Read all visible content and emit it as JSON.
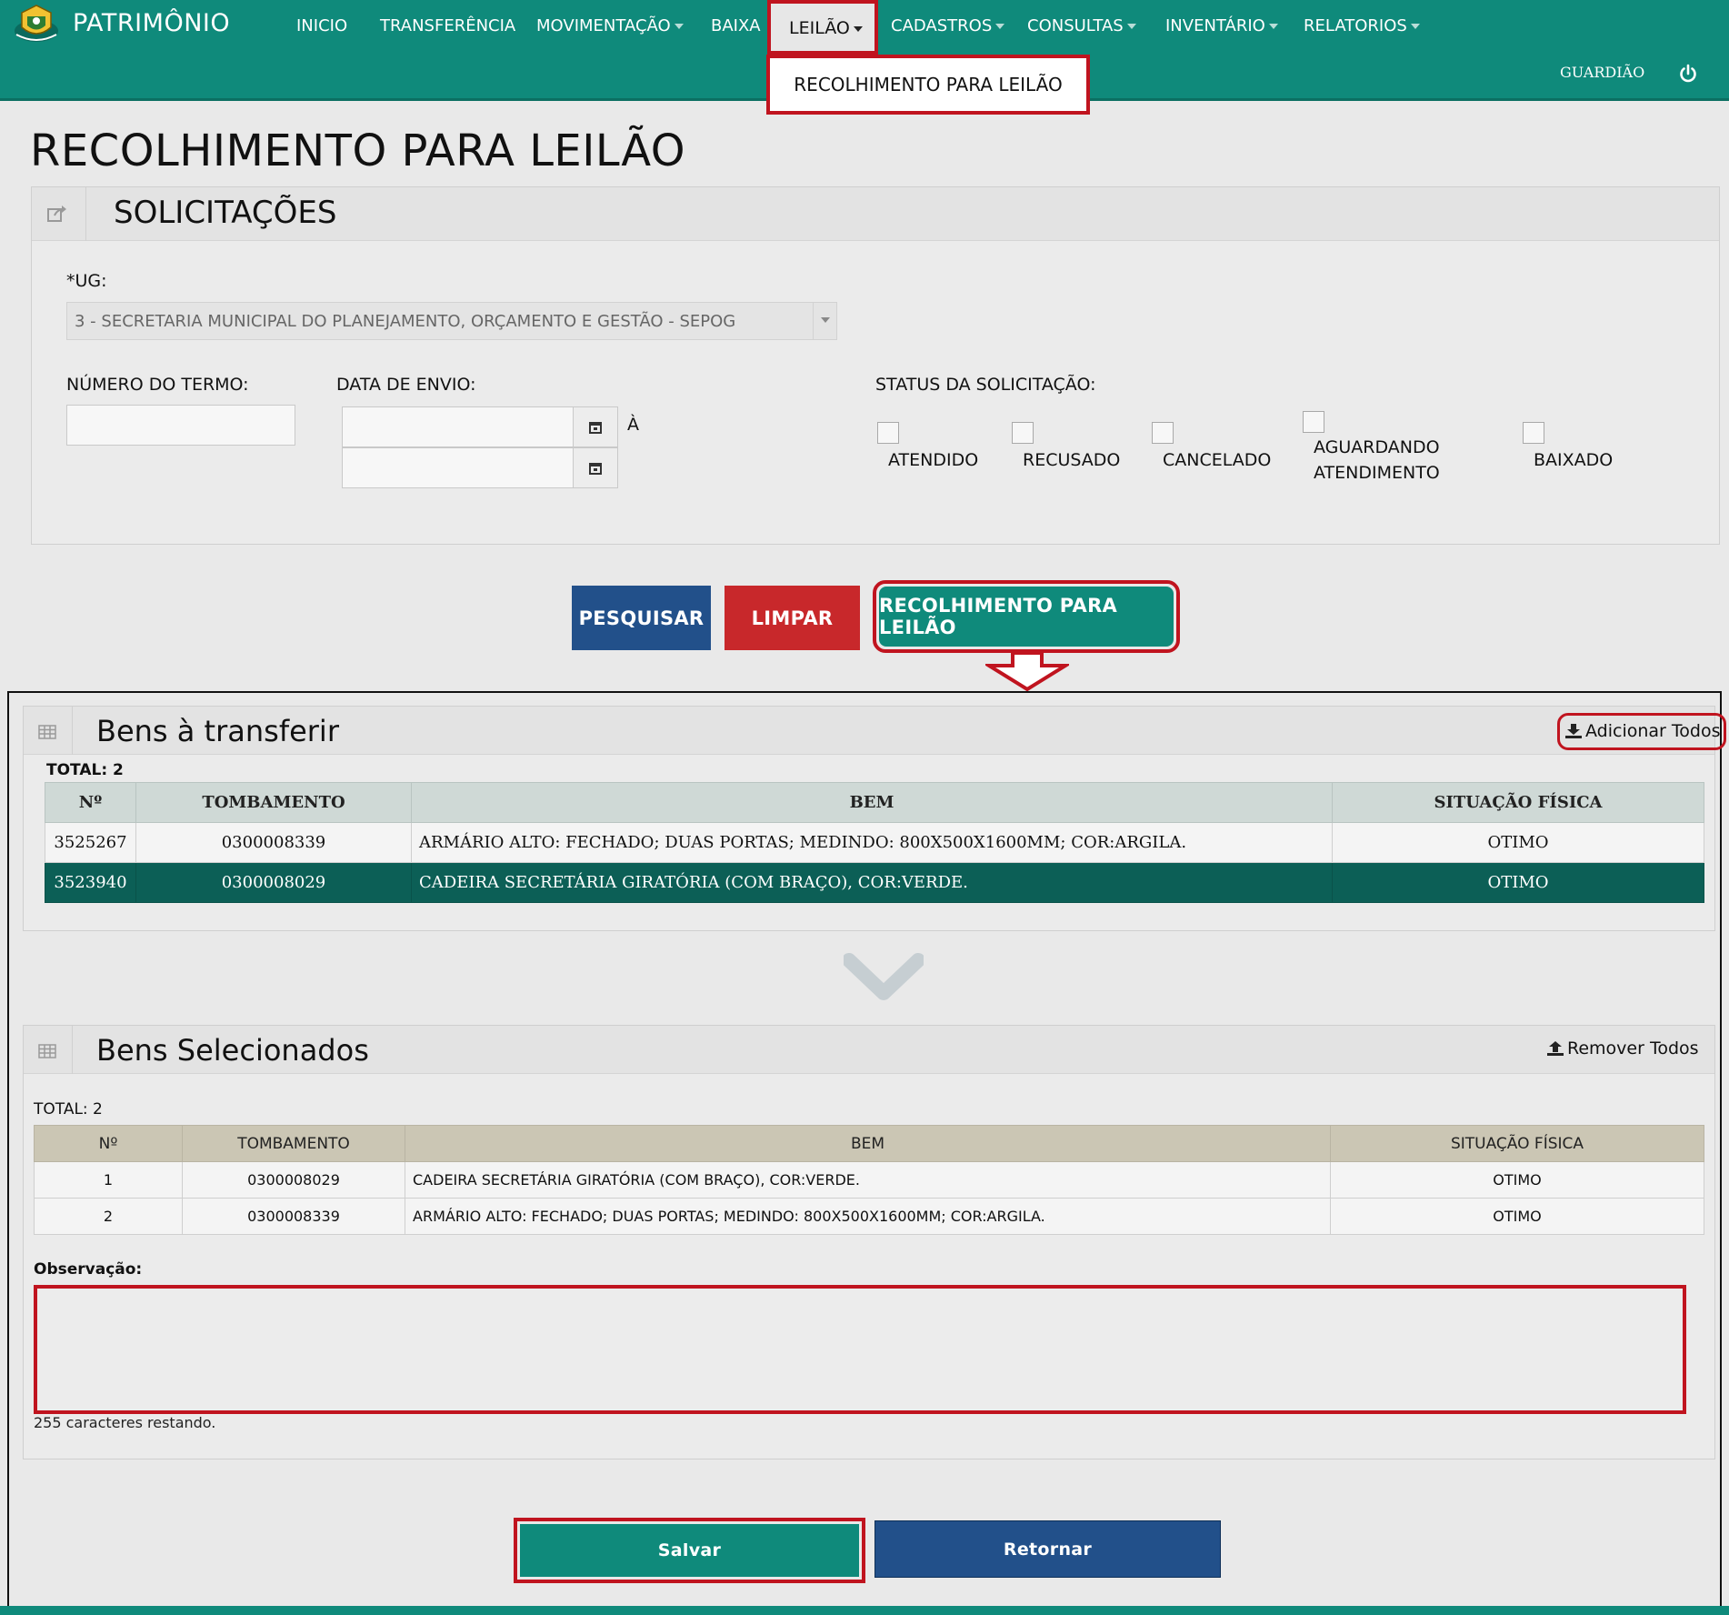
{
  "navbar": {
    "brand": "PATRIMÔNIO",
    "items": [
      {
        "label": "INICIO"
      },
      {
        "label": "TRANSFERÊNCIA"
      },
      {
        "label": "MOVIMENTAÇÃO"
      },
      {
        "label": "BAIXA"
      },
      {
        "label": "LEILÃO"
      },
      {
        "label": "CADASTROS"
      },
      {
        "label": "CONSULTAS"
      },
      {
        "label": "INVENTÁRIO"
      },
      {
        "label": "RELATORIOS"
      }
    ],
    "dropdown_item": "RECOLHIMENTO PARA LEILÃO",
    "user": "GUARDIÃO",
    "icons": {
      "logo": "coat-of-arms-icon",
      "power": "power-icon"
    }
  },
  "page": {
    "title": "RECOLHIMENTO PARA LEILÃO"
  },
  "solicitacoes": {
    "title": "SOLICITAÇÕES",
    "ug_label": "*UG:",
    "ug_value": "3 - SECRETARIA MUNICIPAL DO PLANEJAMENTO, ORÇAMENTO E GESTÃO - SEPOG",
    "numero_label": "NÚMERO DO TERMO:",
    "numero_value": "",
    "data_label": "DATA DE ENVIO:",
    "data_inicio": "",
    "data_fim": "",
    "ate_label": "À",
    "status_label": "STATUS DA SOLICITAÇÃO:",
    "status": [
      {
        "label": "ATENDIDO",
        "checked": false
      },
      {
        "label": "RECUSADO",
        "checked": false
      },
      {
        "label": "CANCELADO",
        "checked": false
      },
      {
        "label": "AGUARDANDO ATENDIMENTO",
        "checked": false
      },
      {
        "label": "BAIXADO",
        "checked": false
      }
    ]
  },
  "buttons": {
    "pesquisar": "PESQUISAR",
    "limpar": "LIMPAR",
    "recolhimento": "RECOLHIMENTO PARA LEILÃO"
  },
  "bens_transferir": {
    "title": "Bens à transferir",
    "add_all": "Adicionar Todos",
    "total": "TOTAL: 2",
    "headers": [
      "Nº",
      "TOMBAMENTO",
      "BEM",
      "SITUAÇÃO FÍSICA"
    ],
    "rows": [
      {
        "n": "3525267",
        "tombamento": "0300008339",
        "bem": "ARMÁRIO ALTO: FECHADO; DUAS PORTAS; MEDINDO: 800X500X1600MM; COR:ARGILA.",
        "situacao": "OTIMO",
        "selected": false
      },
      {
        "n": "3523940",
        "tombamento": "0300008029",
        "bem": "CADEIRA SECRETÁRIA GIRATÓRIA (COM BRAÇO), COR:VERDE.",
        "situacao": "OTIMO",
        "selected": true
      }
    ]
  },
  "bens_selecionados": {
    "title": "Bens Selecionados",
    "remove_all": "Remover Todos",
    "total": "TOTAL: 2",
    "headers": [
      "Nº",
      "TOMBAMENTO",
      "BEM",
      "SITUAÇÃO FÍSICA"
    ],
    "rows": [
      {
        "n": "1",
        "tombamento": "0300008029",
        "bem": "CADEIRA SECRETÁRIA GIRATÓRIA (COM BRAÇO), COR:VERDE.",
        "situacao": "OTIMO"
      },
      {
        "n": "2",
        "tombamento": "0300008339",
        "bem": "ARMÁRIO ALTO: FECHADO; DUAS PORTAS; MEDINDO: 800X500X1600MM; COR:ARGILA.",
        "situacao": "OTIMO"
      }
    ],
    "obs_label": "Observação:",
    "obs_value": "",
    "chars_remaining": "255 caracteres restando."
  },
  "footer_buttons": {
    "salvar": "Salvar",
    "retornar": "Retornar"
  },
  "colors": {
    "primary": "#0f8a7b",
    "blue": "#22508a",
    "red": "#c8282b",
    "highlight": "#c0141f"
  }
}
